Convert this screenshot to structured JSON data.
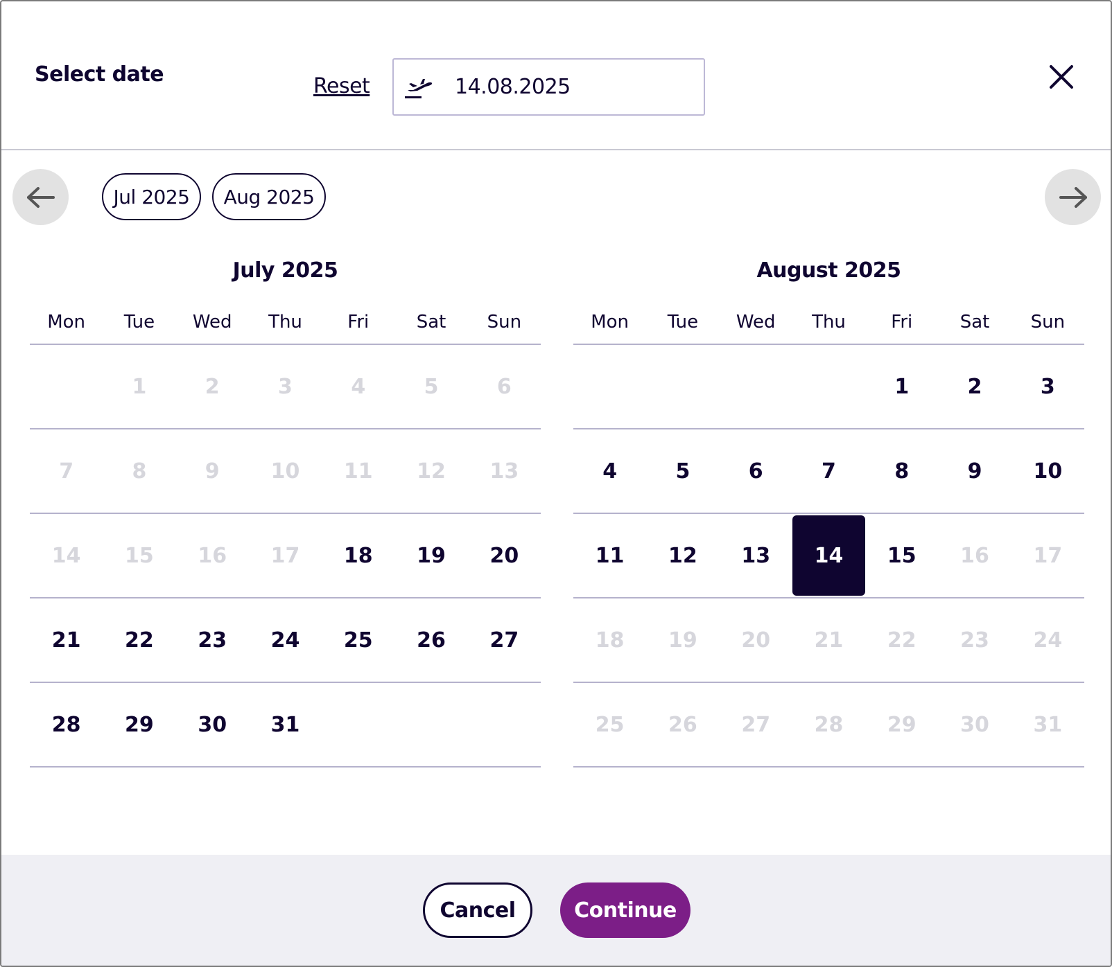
{
  "header": {
    "title": "Select date",
    "reset_label": "Reset",
    "date_value": "14.08.2025",
    "date_icon": "plane-departure-icon",
    "close_icon": "close-icon"
  },
  "nav": {
    "prev_icon": "arrow-left-icon",
    "next_icon": "arrow-right-icon",
    "chips": [
      "Jul 2025",
      "Aug 2025"
    ]
  },
  "weekdays": [
    "Mon",
    "Tue",
    "Wed",
    "Thu",
    "Fri",
    "Sat",
    "Sun"
  ],
  "months": [
    {
      "title": "July 2025",
      "weeks": [
        [
          {
            "d": ""
          },
          {
            "d": "1",
            "s": "disabled"
          },
          {
            "d": "2",
            "s": "disabled"
          },
          {
            "d": "3",
            "s": "disabled"
          },
          {
            "d": "4",
            "s": "disabled"
          },
          {
            "d": "5",
            "s": "disabled"
          },
          {
            "d": "6",
            "s": "disabled"
          }
        ],
        [
          {
            "d": "7",
            "s": "disabled"
          },
          {
            "d": "8",
            "s": "disabled"
          },
          {
            "d": "9",
            "s": "disabled"
          },
          {
            "d": "10",
            "s": "disabled"
          },
          {
            "d": "11",
            "s": "disabled"
          },
          {
            "d": "12",
            "s": "disabled"
          },
          {
            "d": "13",
            "s": "disabled"
          }
        ],
        [
          {
            "d": "14",
            "s": "disabled"
          },
          {
            "d": "15",
            "s": "disabled"
          },
          {
            "d": "16",
            "s": "disabled"
          },
          {
            "d": "17",
            "s": "disabled"
          },
          {
            "d": "18"
          },
          {
            "d": "19"
          },
          {
            "d": "20"
          }
        ],
        [
          {
            "d": "21"
          },
          {
            "d": "22"
          },
          {
            "d": "23"
          },
          {
            "d": "24"
          },
          {
            "d": "25"
          },
          {
            "d": "26"
          },
          {
            "d": "27"
          }
        ],
        [
          {
            "d": "28"
          },
          {
            "d": "29"
          },
          {
            "d": "30"
          },
          {
            "d": "31"
          },
          {
            "d": ""
          },
          {
            "d": ""
          },
          {
            "d": ""
          }
        ]
      ]
    },
    {
      "title": "August 2025",
      "weeks": [
        [
          {
            "d": ""
          },
          {
            "d": ""
          },
          {
            "d": ""
          },
          {
            "d": ""
          },
          {
            "d": "1"
          },
          {
            "d": "2"
          },
          {
            "d": "3"
          }
        ],
        [
          {
            "d": "4"
          },
          {
            "d": "5"
          },
          {
            "d": "6"
          },
          {
            "d": "7"
          },
          {
            "d": "8"
          },
          {
            "d": "9"
          },
          {
            "d": "10"
          }
        ],
        [
          {
            "d": "11"
          },
          {
            "d": "12"
          },
          {
            "d": "13"
          },
          {
            "d": "14",
            "s": "selected"
          },
          {
            "d": "15"
          },
          {
            "d": "16",
            "s": "disabled"
          },
          {
            "d": "17",
            "s": "disabled"
          }
        ],
        [
          {
            "d": "18",
            "s": "disabled"
          },
          {
            "d": "19",
            "s": "disabled"
          },
          {
            "d": "20",
            "s": "disabled"
          },
          {
            "d": "21",
            "s": "disabled"
          },
          {
            "d": "22",
            "s": "disabled"
          },
          {
            "d": "23",
            "s": "disabled"
          },
          {
            "d": "24",
            "s": "disabled"
          }
        ],
        [
          {
            "d": "25",
            "s": "disabled"
          },
          {
            "d": "26",
            "s": "disabled"
          },
          {
            "d": "27",
            "s": "disabled"
          },
          {
            "d": "28",
            "s": "disabled"
          },
          {
            "d": "29",
            "s": "disabled"
          },
          {
            "d": "30",
            "s": "disabled"
          },
          {
            "d": "31",
            "s": "disabled"
          }
        ]
      ]
    }
  ],
  "footer": {
    "cancel_label": "Cancel",
    "continue_label": "Continue"
  },
  "colors": {
    "text": "#0f0530",
    "accent": "#7c1e87",
    "selected_bg": "#0f0530",
    "disabled_text": "#d6d6dc"
  }
}
